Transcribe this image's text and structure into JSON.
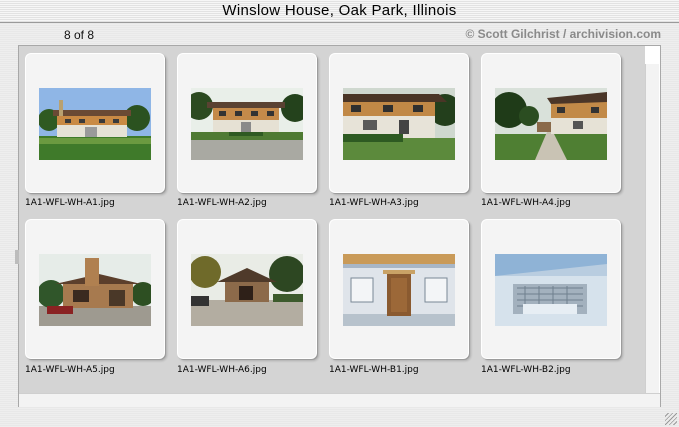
{
  "window": {
    "title": "Winslow House, Oak Park, Illinois"
  },
  "header": {
    "counter": "8 of 8",
    "credit": "© Scott Gilchrist / archivision.com"
  },
  "slides": [
    {
      "filename": "1A1-WFL-WH-A1.jpg"
    },
    {
      "filename": "1A1-WFL-WH-A2.jpg"
    },
    {
      "filename": "1A1-WFL-WH-A3.jpg"
    },
    {
      "filename": "1A1-WFL-WH-A4.jpg"
    },
    {
      "filename": "1A1-WFL-WH-A5.jpg"
    },
    {
      "filename": "1A1-WFL-WH-A6.jpg"
    },
    {
      "filename": "1A1-WFL-WH-B1.jpg"
    },
    {
      "filename": "1A1-WFL-WH-B2.jpg"
    }
  ]
}
